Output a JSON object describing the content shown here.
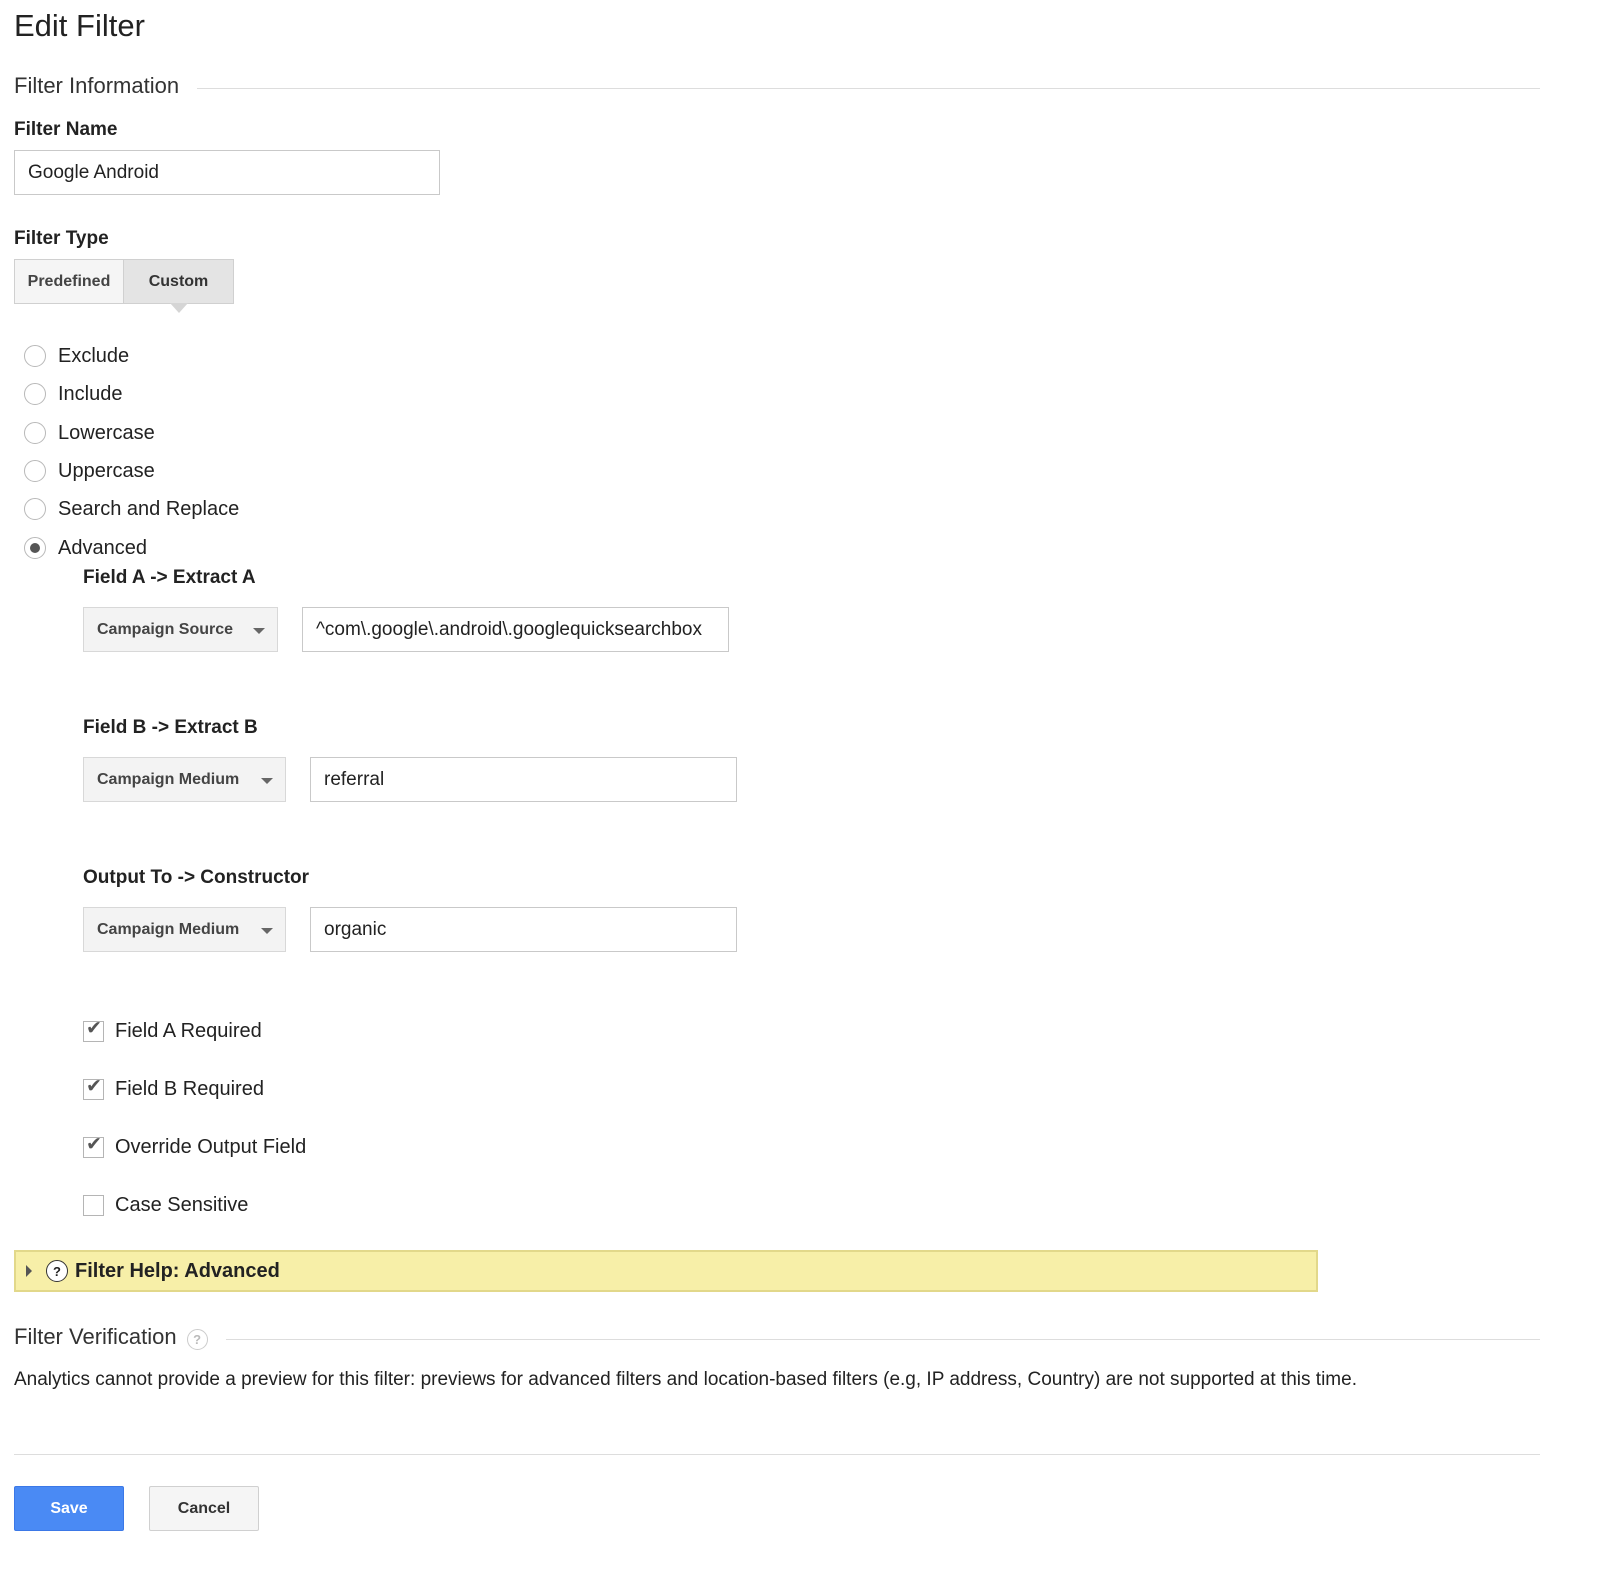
{
  "page": {
    "title": "Edit Filter"
  },
  "filter_information": {
    "section_title": "Filter Information",
    "name_label": "Filter Name",
    "name_value": "Google Android",
    "type_label": "Filter Type",
    "type_tabs": [
      "Predefined",
      "Custom"
    ],
    "selected_type_tab": "Custom"
  },
  "custom_options": {
    "items": [
      "Exclude",
      "Include",
      "Lowercase",
      "Uppercase",
      "Search and Replace",
      "Advanced"
    ],
    "selected": "Advanced"
  },
  "advanced": {
    "field_a": {
      "label": "Field A -> Extract A",
      "select": "Campaign Source",
      "value": "^com\\.google\\.android\\.googlequicksearchbox"
    },
    "field_b": {
      "label": "Field B -> Extract B",
      "select": "Campaign Medium",
      "value": "referral"
    },
    "output": {
      "label": "Output To -> Constructor",
      "select": "Campaign Medium",
      "value": "organic"
    },
    "checkboxes": [
      {
        "label": "Field A Required",
        "checked": true
      },
      {
        "label": "Field B Required",
        "checked": true
      },
      {
        "label": "Override Output Field",
        "checked": true
      },
      {
        "label": "Case Sensitive",
        "checked": false
      }
    ]
  },
  "filter_help": {
    "title": "Filter Help: Advanced",
    "icon": "question-circle-icon",
    "background": "#f7efa8"
  },
  "filter_verification": {
    "section_title": "Filter Verification",
    "help_icon": "?",
    "message": "Analytics cannot provide a preview for this filter: previews for advanced filters and location-based filters (e.g, IP address, Country) are not supported at this time."
  },
  "actions": {
    "save_label": "Save",
    "cancel_label": "Cancel",
    "save_color": "#4a8af4"
  }
}
